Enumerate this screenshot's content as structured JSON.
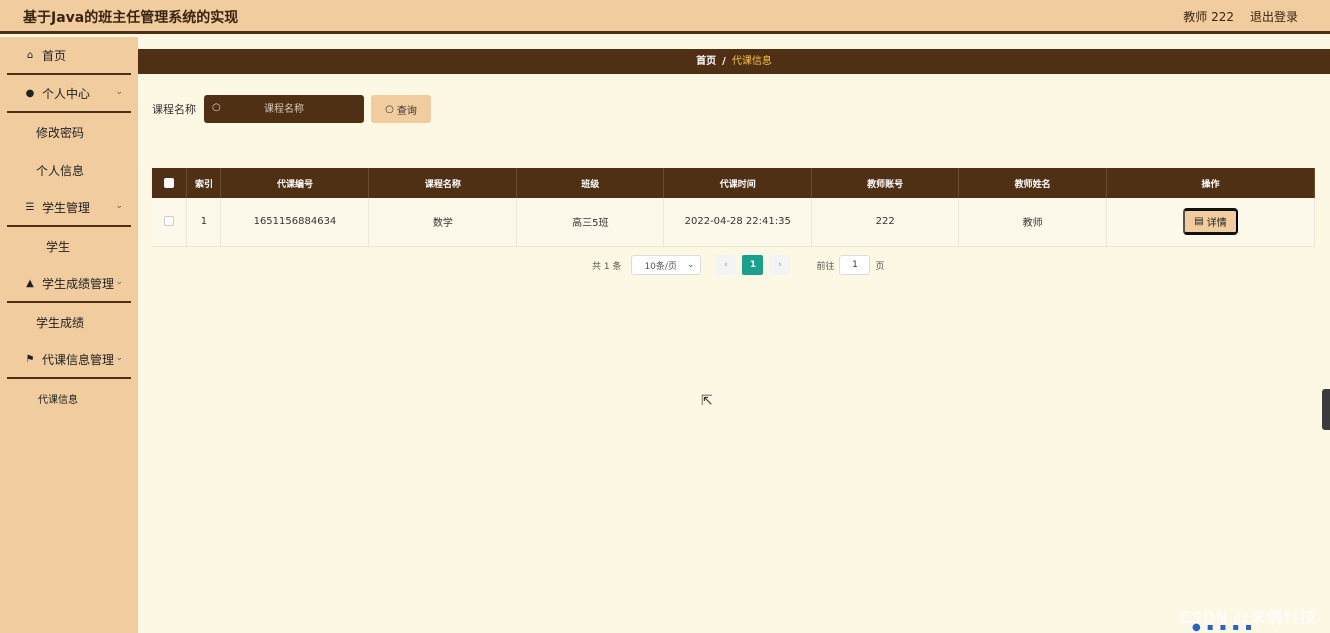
{
  "app": {
    "title": "基于Java的班主任管理系统的实现"
  },
  "header": {
    "user_label": "教师 222",
    "logout_label": "退出登录"
  },
  "sidebar": {
    "home": "首页",
    "personal_center": "个人中心",
    "change_password": "修改密码",
    "personal_info": "个人信息",
    "student_mgmt": "学生管理",
    "student": "学生",
    "score_mgmt": "学生成绩管理",
    "student_score": "学生成绩",
    "substitute_mgmt": "代课信息管理",
    "substitute_info": "代课信息"
  },
  "breadcrumb": {
    "home": "首页",
    "sep": "/",
    "current": "代课信息"
  },
  "search": {
    "label": "课程名称",
    "placeholder": "课程名称",
    "query_label": "查询"
  },
  "table": {
    "headers": [
      "索引",
      "代课编号",
      "课程名称",
      "班级",
      "代课时间",
      "教师账号",
      "教师姓名",
      "操作"
    ],
    "rows": [
      {
        "index": "1",
        "code": "1651156884634",
        "course": "数学",
        "class": "高三5班",
        "time": "2022-04-28 22:41:35",
        "account": "222",
        "name": "教师",
        "action": "详情"
      }
    ]
  },
  "pagination": {
    "total": "共 1 条",
    "page_size": "10条/页",
    "current_page": "1",
    "goto_label": "前往",
    "goto_value": "1",
    "page_unit": "页"
  },
  "watermark": "CSDN @米偶科技",
  "colors": {
    "header_bg": "#f0cc9f",
    "dark_brown": "#4f3015",
    "page_bg": "#fdf8e3",
    "accent_green": "#1aa08c",
    "breadcrumb_current": "#f5c542"
  }
}
